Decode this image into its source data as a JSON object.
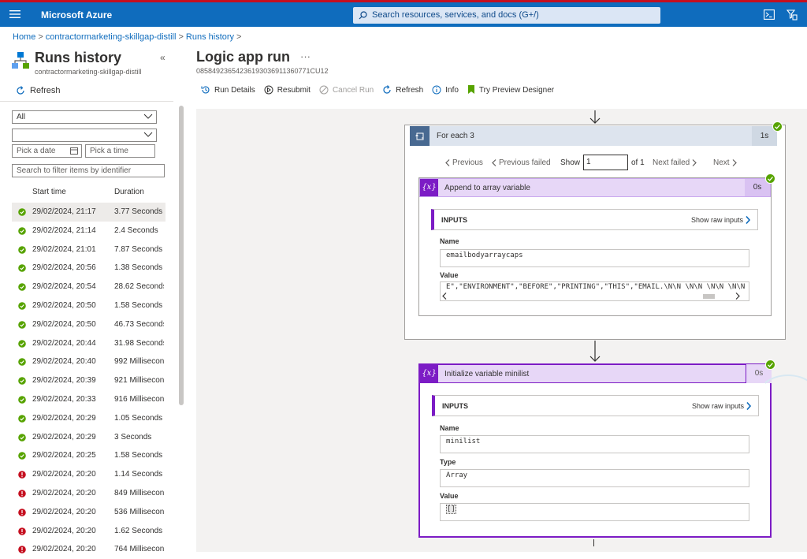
{
  "topbar": {
    "brand": "Microsoft Azure",
    "search_placeholder": "Search resources, services, and docs (G+/)"
  },
  "breadcrumb": [
    "Home",
    "contractormarketing-skillgap-distill",
    "Runs history"
  ],
  "left_panel": {
    "title": "Runs history",
    "subtitle": "contractormarketing-skillgap-distill",
    "refresh": "Refresh",
    "filter_status": "All",
    "filter_second": "",
    "date_placeholder": "Pick a date",
    "time_placeholder": "Pick a time",
    "search_placeholder": "Search to filter items by identifier",
    "col_start": "Start time",
    "col_duration": "Duration",
    "runs": [
      {
        "status": "success",
        "start": "29/02/2024, 21:17",
        "duration": "3.77 Seconds"
      },
      {
        "status": "success",
        "start": "29/02/2024, 21:14",
        "duration": "2.4 Seconds"
      },
      {
        "status": "success",
        "start": "29/02/2024, 21:01",
        "duration": "7.87 Seconds"
      },
      {
        "status": "success",
        "start": "29/02/2024, 20:56",
        "duration": "1.38 Seconds"
      },
      {
        "status": "success",
        "start": "29/02/2024, 20:54",
        "duration": "28.62 Seconds"
      },
      {
        "status": "success",
        "start": "29/02/2024, 20:50",
        "duration": "1.58 Seconds"
      },
      {
        "status": "success",
        "start": "29/02/2024, 20:50",
        "duration": "46.73 Seconds"
      },
      {
        "status": "success",
        "start": "29/02/2024, 20:44",
        "duration": "31.98 Seconds"
      },
      {
        "status": "success",
        "start": "29/02/2024, 20:40",
        "duration": "992 Milliseconds"
      },
      {
        "status": "success",
        "start": "29/02/2024, 20:39",
        "duration": "921 Milliseconds"
      },
      {
        "status": "success",
        "start": "29/02/2024, 20:33",
        "duration": "916 Milliseconds"
      },
      {
        "status": "success",
        "start": "29/02/2024, 20:29",
        "duration": "1.05 Seconds"
      },
      {
        "status": "success",
        "start": "29/02/2024, 20:29",
        "duration": "3 Seconds"
      },
      {
        "status": "success",
        "start": "29/02/2024, 20:25",
        "duration": "1.58 Seconds"
      },
      {
        "status": "failed",
        "start": "29/02/2024, 20:20",
        "duration": "1.14 Seconds"
      },
      {
        "status": "failed",
        "start": "29/02/2024, 20:20",
        "duration": "849 Milliseconds"
      },
      {
        "status": "failed",
        "start": "29/02/2024, 20:20",
        "duration": "536 Milliseconds"
      },
      {
        "status": "failed",
        "start": "29/02/2024, 20:20",
        "duration": "1.62 Seconds"
      },
      {
        "status": "failed",
        "start": "29/02/2024, 20:20",
        "duration": "764 Milliseconds"
      }
    ]
  },
  "main": {
    "title": "Logic app run",
    "run_id": "08584923654236193036911360771CU12",
    "toolbar": {
      "run_details": "Run Details",
      "resubmit": "Resubmit",
      "cancel_run": "Cancel Run",
      "refresh": "Refresh",
      "info": "Info",
      "preview": "Try Preview Designer"
    },
    "foreach": {
      "title": "For each 3",
      "duration": "1s",
      "previous": "Previous",
      "previous_failed": "Previous failed",
      "show": "Show",
      "page": "1",
      "of": "of 1",
      "next_failed": "Next failed",
      "next": "Next"
    },
    "append_action": {
      "title": "Append to array variable",
      "duration": "0s",
      "inputs_label": "INPUTS",
      "show_raw": "Show raw inputs",
      "name_label": "Name",
      "name_value": "emailbodyarraycaps",
      "value_label": "Value",
      "value_value": "E\",\"ENVIRONMENT\",\"BEFORE\",\"PRINTING\",\"THIS\",\"EMAIL.\\N\\N \\N\\N \\N\\N \\N\\N \\"
    },
    "init_action": {
      "title": "Initialize variable minilist",
      "duration": "0s",
      "inputs_label": "INPUTS",
      "show_raw": "Show raw inputs",
      "name_label": "Name",
      "name_value": "minilist",
      "type_label": "Type",
      "type_value": "Array",
      "value_label": "Value",
      "value_value": "[]"
    }
  },
  "colors": {
    "brand": "#0f6cbd",
    "success": "#57a300",
    "failed": "#c50f1f",
    "variable": "#7c1cc5",
    "foreach": "#486991"
  }
}
